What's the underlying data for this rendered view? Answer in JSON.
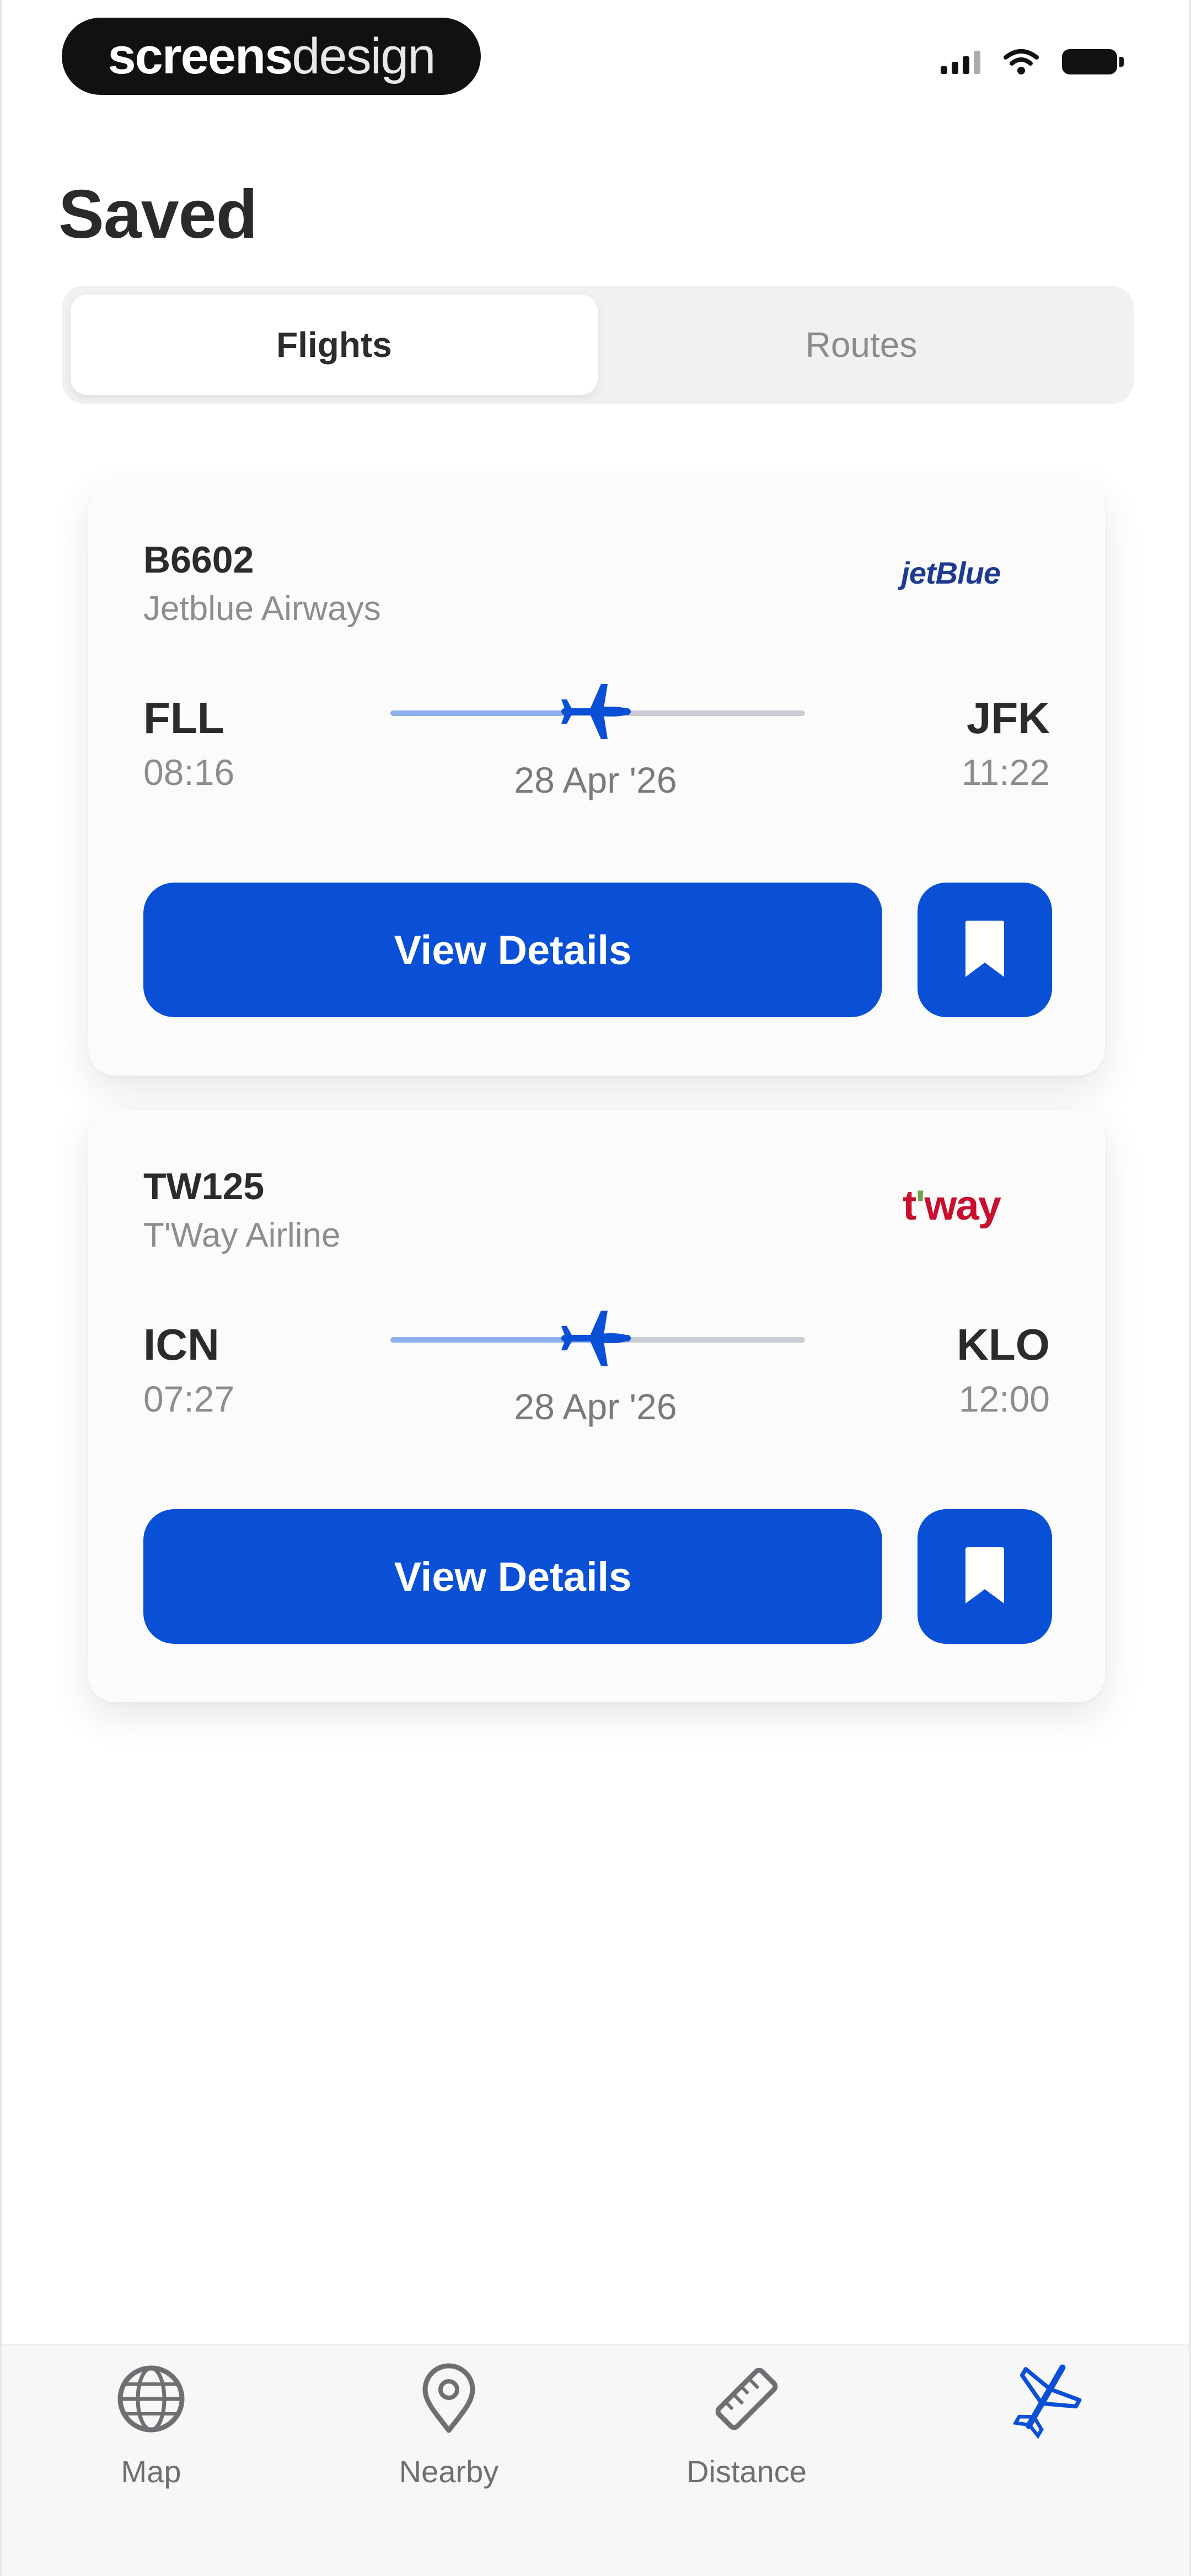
{
  "status_bar": {
    "brand_bold": "screens",
    "brand_light": "design"
  },
  "header": {
    "title": "Saved"
  },
  "tabs": [
    {
      "label": "Flights",
      "active": true
    },
    {
      "label": "Routes",
      "active": false
    }
  ],
  "flights": [
    {
      "flight_number": "B6602",
      "airline": "Jetblue Airways",
      "logo_text": "jetBlue",
      "origin": "FLL",
      "departure_time": "08:16",
      "destination": "JFK",
      "arrival_time": "11:22",
      "date": "28 Apr '26",
      "action_label": "View Details"
    },
    {
      "flight_number": "TW125",
      "airline": "T'Way Airline",
      "logo_text_main": "t",
      "logo_text_apostrophe": "'",
      "logo_text_rest": "way",
      "origin": "ICN",
      "departure_time": "07:27",
      "destination": "KLO",
      "arrival_time": "12:00",
      "date": "28 Apr '26",
      "action_label": "View Details"
    }
  ],
  "bottom_nav": [
    {
      "label": "Map",
      "icon": "globe-icon",
      "active": false
    },
    {
      "label": "Nearby",
      "icon": "location-pin-icon",
      "active": false
    },
    {
      "label": "Distance",
      "icon": "ruler-icon",
      "active": false
    },
    {
      "label": "",
      "icon": "plane-icon",
      "active": true
    }
  ],
  "colors": {
    "accent": "#0a50d6",
    "route_progress": "#8fb0ee",
    "route_remaining": "#c9ccd4",
    "jetblue": "#1f3b8f",
    "tway": "#c8102e"
  }
}
